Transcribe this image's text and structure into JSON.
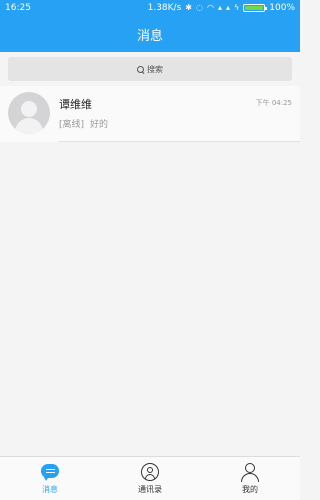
{
  "status_bar": {
    "time": "16:25",
    "speed": "1.38K/s",
    "battery_label": "100%",
    "battery_level": 1.0,
    "icons": [
      "bluetooth-icon",
      "silent-icon",
      "wifi-icon",
      "signal-icon",
      "signal-icon",
      "charging-icon"
    ]
  },
  "header": {
    "title": "消息"
  },
  "search": {
    "placeholder": "搜索"
  },
  "conversations": [
    {
      "name": "谭维维",
      "time": "下午 04:25",
      "status": "[离线]",
      "message": "好的"
    }
  ],
  "bottom_nav": {
    "items": [
      {
        "label": "消息",
        "icon": "chat-icon",
        "active": true
      },
      {
        "label": "通讯录",
        "icon": "contacts-icon",
        "active": false
      },
      {
        "label": "我的",
        "icon": "me-icon",
        "active": false
      }
    ]
  },
  "colors": {
    "primary": "#26a1f4",
    "background": "#f4f4f4",
    "muted_text": "#9a9a9a"
  }
}
